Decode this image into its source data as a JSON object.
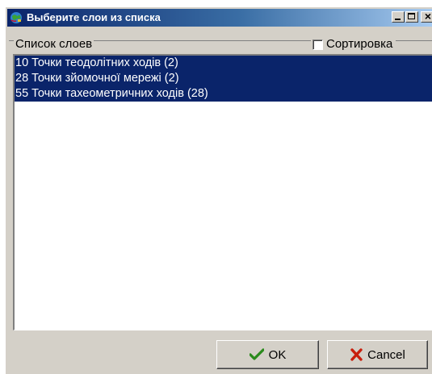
{
  "window": {
    "title": "Выберите слои из списка",
    "controls": {
      "minimize": "_",
      "maximize": "□",
      "close": "×"
    }
  },
  "group": {
    "legend": "Список слоев",
    "sort_label": "Сортировка",
    "sort_checked": false
  },
  "list": {
    "items": [
      {
        "label": "10 Точки теодолітних ходів (2)",
        "selected": true
      },
      {
        "label": "28 Точки зйомочної мережі (2)",
        "selected": true
      },
      {
        "label": "55 Точки тахеометричних ходів (28)",
        "selected": true
      }
    ]
  },
  "buttons": {
    "ok_label": "OK",
    "cancel_label": "Cancel"
  },
  "colors": {
    "selection": "#0a246a",
    "face": "#d4d0c8",
    "ok_icon": "#2a8a1c",
    "cancel_icon": "#c81e0c"
  },
  "icons": {
    "app": "globe-app-icon",
    "ok": "check-icon",
    "cancel": "x-icon"
  }
}
